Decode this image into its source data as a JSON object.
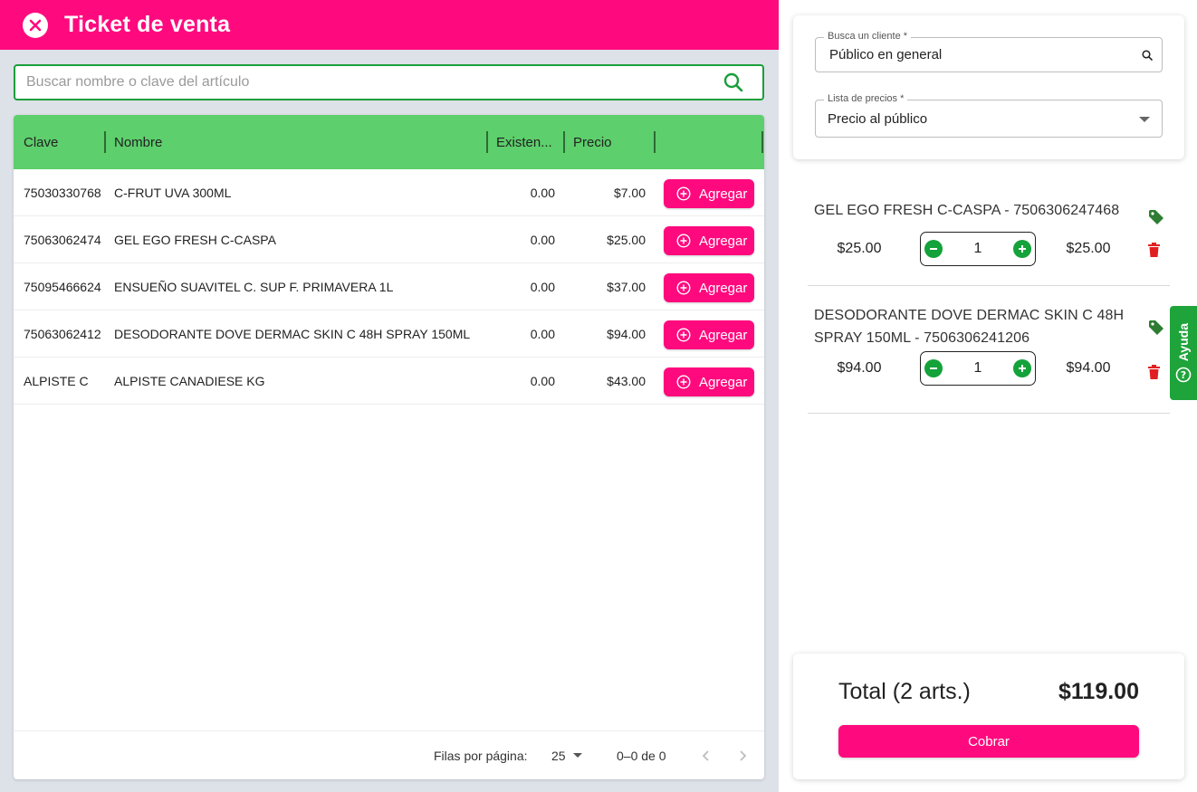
{
  "header": {
    "title": "Ticket de venta"
  },
  "search": {
    "placeholder": "Buscar nombre o clave del artículo",
    "value": ""
  },
  "table": {
    "columns": {
      "clave": "Clave",
      "nombre": "Nombre",
      "existencia": "Existen...",
      "precio": "Precio"
    },
    "add_label": "Agregar",
    "rows": [
      {
        "clave": "75030330768",
        "nombre": "C-FRUT UVA 300ML",
        "existencia": "0.00",
        "precio": "$7.00"
      },
      {
        "clave": "75063062474",
        "nombre": "GEL EGO FRESH C-CASPA",
        "existencia": "0.00",
        "precio": "$25.00"
      },
      {
        "clave": "75095466624",
        "nombre": "ENSUEÑO SUAVITEL C. SUP F. PRIMAVERA 1L",
        "existencia": "0.00",
        "precio": "$37.00"
      },
      {
        "clave": "75063062412",
        "nombre": "DESODORANTE DOVE DERMAC SKIN C 48H SPRAY 150ML",
        "existencia": "0.00",
        "precio": "$94.00"
      },
      {
        "clave": "ALPISTE C",
        "nombre": "ALPISTE CANADIESE KG",
        "existencia": "0.00",
        "precio": "$43.00"
      }
    ]
  },
  "pagination": {
    "rows_label": "Filas por página:",
    "rows_value": "25",
    "range": "0–0 de 0"
  },
  "client": {
    "customer_label": "Busca un cliente *",
    "customer_value": "Público en general",
    "price_list_label": "Lista de precios *",
    "price_list_value": "Precio al público"
  },
  "cart": {
    "items": [
      {
        "name": "GEL EGO FRESH C-CASPA - 7506306247468",
        "unit_price": "$25.00",
        "qty": "1",
        "subtotal": "$25.00"
      },
      {
        "name": "DESODORANTE DOVE DERMAC SKIN C 48H SPRAY 150ML - 7506306241206",
        "unit_price": "$94.00",
        "qty": "1",
        "subtotal": "$94.00"
      }
    ]
  },
  "help": {
    "label": "Ayuda"
  },
  "total": {
    "label": "Total (2 arts.)",
    "value": "$119.00",
    "charge_label": "Cobrar"
  },
  "colors": {
    "brand": "#ff0a7e",
    "accent_green": "#14a23a",
    "header_green": "#5dcf6c",
    "danger": "#e02020",
    "tag": "#2e7d32"
  }
}
